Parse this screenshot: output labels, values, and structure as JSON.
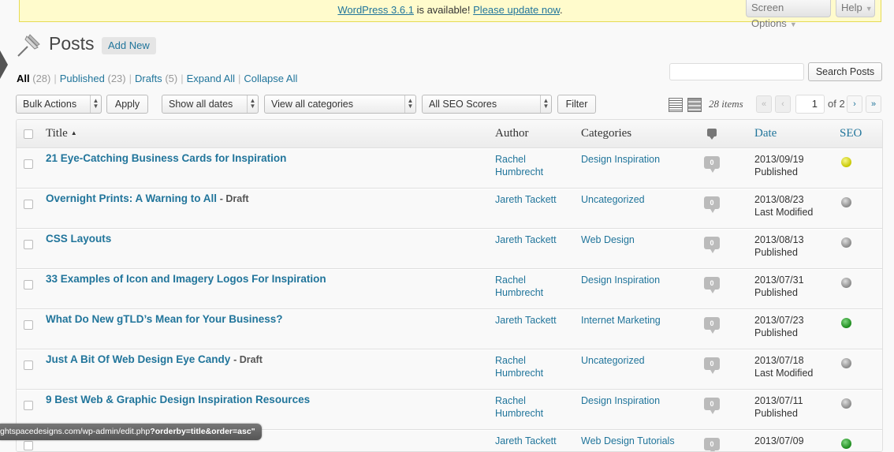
{
  "notice": {
    "update_link": "WordPress 3.6.1",
    "text_middle": "is available!",
    "please_update": "Please update now",
    "text_end": "."
  },
  "screen_options": "Screen Options",
  "help": "Help",
  "page": {
    "title": "Posts",
    "add_new": "Add New"
  },
  "filters": {
    "all_label": "All",
    "all_count": "(28)",
    "published_label": "Published",
    "published_count": "(23)",
    "drafts_label": "Drafts",
    "drafts_count": "(5)",
    "expand_all": "Expand All",
    "collapse_all": "Collapse All",
    "separator": "|"
  },
  "search": {
    "button": "Search Posts",
    "value": ""
  },
  "toolbar": {
    "bulk_actions": "Bulk Actions",
    "apply": "Apply",
    "dates": "Show all dates",
    "categories": "View all categories",
    "seo_scores": "All SEO Scores",
    "filter": "Filter"
  },
  "pagination": {
    "items": "28 items",
    "first": "«",
    "prev": "‹",
    "current": "1",
    "of": "of 2",
    "next": "›",
    "last": "»"
  },
  "table": {
    "headers": {
      "title": "Title",
      "author": "Author",
      "categories": "Categories",
      "date": "Date",
      "seo": "SEO"
    },
    "rows": [
      {
        "title": "21 Eye-Catching Business Cards for Inspiration",
        "state": "",
        "author": "Rachel Humbrecht",
        "category": "Design Inspiration",
        "comments": "0",
        "date": "2013/09/19",
        "status": "Published",
        "seo": "yellow"
      },
      {
        "title": "Overnight Prints: A Warning to All",
        "state": "- Draft",
        "author": "Jareth Tackett",
        "category": "Uncategorized",
        "comments": "0",
        "date": "2013/08/23",
        "status": "Last Modified",
        "seo": "gray"
      },
      {
        "title": "CSS Layouts",
        "state": "",
        "author": "Jareth Tackett",
        "category": "Web Design",
        "comments": "0",
        "date": "2013/08/13",
        "status": "Published",
        "seo": "gray"
      },
      {
        "title": "33 Examples of Icon and Imagery Logos For Inspiration",
        "state": "",
        "author": "Rachel Humbrecht",
        "category": "Design Inspiration",
        "comments": "0",
        "date": "2013/07/31",
        "status": "Published",
        "seo": "gray"
      },
      {
        "title": "What Do New gTLD’s Mean for Your Business?",
        "state": "",
        "author": "Jareth Tackett",
        "category": "Internet Marketing",
        "comments": "0",
        "date": "2013/07/23",
        "status": "Published",
        "seo": "green"
      },
      {
        "title": "Just A Bit Of Web Design Eye Candy",
        "state": "- Draft",
        "author": "Rachel Humbrecht",
        "category": "Uncategorized",
        "comments": "0",
        "date": "2013/07/18",
        "status": "Last Modified",
        "seo": "gray"
      },
      {
        "title": "9 Best Web & Graphic Design Inspiration Resources",
        "state": "",
        "author": "Rachel Humbrecht",
        "category": "Design Inspiration",
        "comments": "0",
        "date": "2013/07/11",
        "status": "Published",
        "seo": "gray"
      },
      {
        "title": "",
        "state": "",
        "author": "Jareth Tackett",
        "category": "Web Design Tutorials",
        "comments": "0",
        "date": "2013/07/09",
        "status": "",
        "seo": "green"
      }
    ]
  },
  "status_bar": {
    "url_prefix": "ghtspacedesigns.com/wp-admin/edit.php",
    "url_query": "?orderby=title&order=asc\""
  }
}
